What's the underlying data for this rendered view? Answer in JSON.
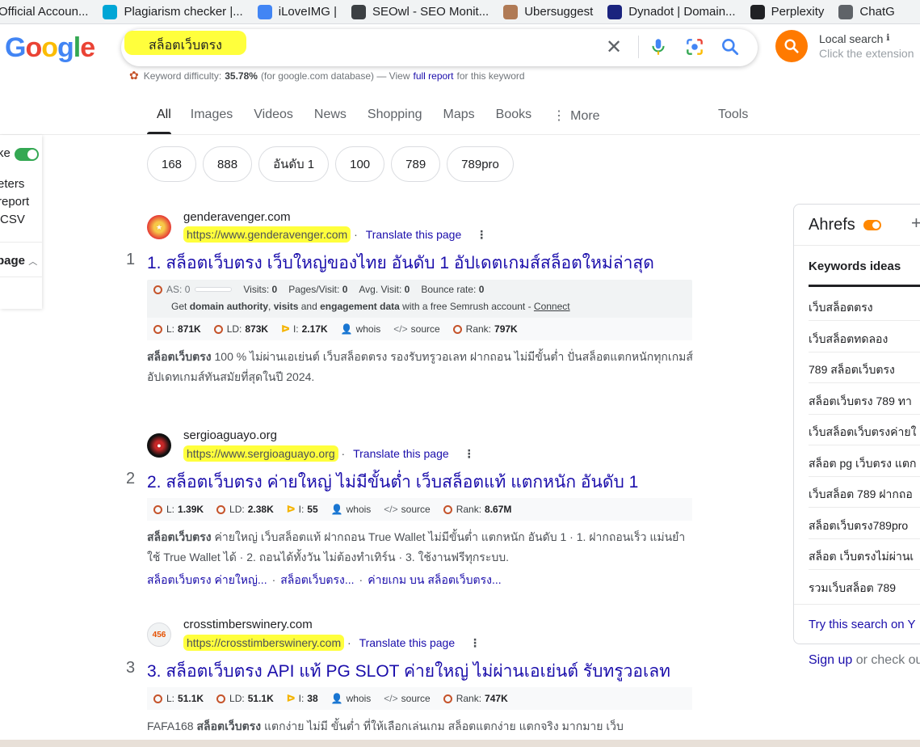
{
  "bookmarks": [
    {
      "label": "Official Accoun...",
      "icon": "doc-icon",
      "color": "#5f6368"
    },
    {
      "label": "Plagiarism checker |...",
      "icon": "plagiarism-icon",
      "color": "#00a6d6"
    },
    {
      "label": "iLoveIMG |",
      "icon": "heart-icon",
      "color": "#4285f4"
    },
    {
      "label": "SEOwl - SEO Monit...",
      "icon": "owl-icon",
      "color": "#3c4043"
    },
    {
      "label": "Ubersuggest",
      "icon": "avatar-icon",
      "color": "#b07a55"
    },
    {
      "label": "Dynadot | Domain...",
      "icon": "dynadot-icon",
      "color": "#1a237e"
    },
    {
      "label": "Perplexity",
      "icon": "perplexity-icon",
      "color": "#202124"
    },
    {
      "label": "ChatG",
      "icon": "chatgpt-icon",
      "color": "#5f6368"
    }
  ],
  "search": {
    "query": "สล็อตเว็บตรง",
    "local_title": "Local search",
    "local_info": "ℹ",
    "local_sub": "Click the extension"
  },
  "keyword_difficulty": {
    "label": "Keyword difficulty:",
    "value": "35.78%",
    "db": "(for google.com database) — View",
    "link": "full report",
    "suffix": "for this keyword"
  },
  "tabs": [
    "All",
    "Images",
    "Videos",
    "News",
    "Shopping",
    "Maps",
    "Books",
    "More"
  ],
  "tools_label": "Tools",
  "chips": [
    "168",
    "888",
    "อันดับ 1",
    "100",
    "789",
    "789pro"
  ],
  "left_panel": {
    "items": [
      "ke",
      "eters",
      "report",
      "CSV",
      "page"
    ]
  },
  "results": [
    {
      "num": "1",
      "site": "genderavenger.com",
      "url": "https://www.genderavenger.com",
      "translate": "Translate this page",
      "title": "1. สล็อตเว็บตรง เว็บใหญ่ของไทย อันดับ 1 อัปเดตเกมส์สล็อตใหม่ล่าสุด",
      "semrush": {
        "as_label": "AS:",
        "as_value": "0",
        "visits_label": "Visits:",
        "visits": "0",
        "pages_label": "Pages/Visit:",
        "pages": "0",
        "avg_label": "Avg. Visit:",
        "avg": "0",
        "bounce_label": "Bounce rate:",
        "bounce": "0",
        "line2_a": "Get",
        "line2_b": "domain authority",
        "line2_c": ",",
        "line2_d": "visits",
        "line2_e": "and",
        "line2_f": "engagement data",
        "line2_g": "with a free Semrush account -",
        "line2_link": "Connect"
      },
      "metrics": {
        "L": "871K",
        "LD": "873K",
        "I": "2.17K",
        "whois": "whois",
        "source": "source",
        "rank": "797K"
      },
      "snippet_bold": "สล็อตเว็บตรง",
      "snippet": "100 % ไม่ผ่านเอเย่นต์ เว็บสล็อตตรง รองรับทรูวอเลท ฝากถอน ไม่มีขั้นต่ำ ปั่นสล็อตแตกหนักทุกเกมส์ อัปเดทเกมส์ทันสมัยที่สุดในปี 2024."
    },
    {
      "num": "2",
      "site": "sergioaguayo.org",
      "url": "https://www.sergioaguayo.org",
      "translate": "Translate this page",
      "title": "2. สล็อตเว็บตรง ค่ายใหญ่ ไม่มีขั้นต่ำ เว็บสล็อตแท้ แตกหนัก อันดับ 1",
      "metrics": {
        "L": "1.39K",
        "LD": "2.38K",
        "I": "55",
        "whois": "whois",
        "source": "source",
        "rank": "8.67M"
      },
      "snippet_bold": "สล็อตเว็บตรง",
      "snippet": "ค่ายใหญ่ เว็บสล็อตแท้ ฝากถอน True Wallet ไม่มีขั้นต่ำ แตกหนัก อันดับ 1 · 1. ฝากถอนเร็ว แม่นยำ ใช้ True Wallet ได้ · 2. ถอนได้ทั้งวัน ไม่ต้องทำเทิร์น · 3. ใช้งานฟรีทุกระบบ.",
      "sublinks": [
        "สล็อตเว็บตรง ค่ายใหญ่...",
        "สล็อตเว็บตรง...",
        "ค่ายเกม บน สล็อตเว็บตรง..."
      ]
    },
    {
      "num": "3",
      "site": "crosstimberswinery.com",
      "url": "https://crosstimberswinery.com",
      "translate": "Translate this page",
      "title": "3. สล็อตเว็บตรง API แท้ PG SLOT ค่ายใหญ่ ไม่ผ่านเอเย่นต์ รับทรูวอเลท",
      "metrics": {
        "L": "51.1K",
        "LD": "51.1K",
        "I": "38",
        "whois": "whois",
        "source": "source",
        "rank": "747K"
      },
      "snippet_pre": "FAFA168",
      "snippet_bold": "สล็อตเว็บตรง",
      "snippet": "แตกง่าย ไม่มี ขั้นต่ำ ที่ให้เลือกเล่นเกม สล็อตแตกง่าย แตกจริง มากมาย เว็บ"
    }
  ],
  "ahrefs": {
    "title": "Ahrefs",
    "tab": "Keywords ideas",
    "items": [
      "เว็บสล็อตตรง",
      "เว็บสล็อตทดลอง",
      "789 สล็อตเว็บตรง",
      "สล็อตเว็บตรง 789 ทา",
      "เว็บสล็อตเว็บตรงค่ายใ",
      "สล็อต pg เว็บตรง แตก",
      "เว็บสล็อต 789 ฝากถอ",
      "สล็อตเว็บตรง789pro",
      "สล็อต เว็บตรงไม่ผ่านเ",
      "รวมเว็บสล็อต 789"
    ],
    "try": "Try this search on Y"
  },
  "signup": {
    "link": "Sign up",
    "text": "or check ou"
  },
  "colors": {
    "accent": "#1a0dab",
    "highlight": "#ffff3c",
    "ahrefs_orange": "#ff8800",
    "semrush": "#c5532a"
  }
}
